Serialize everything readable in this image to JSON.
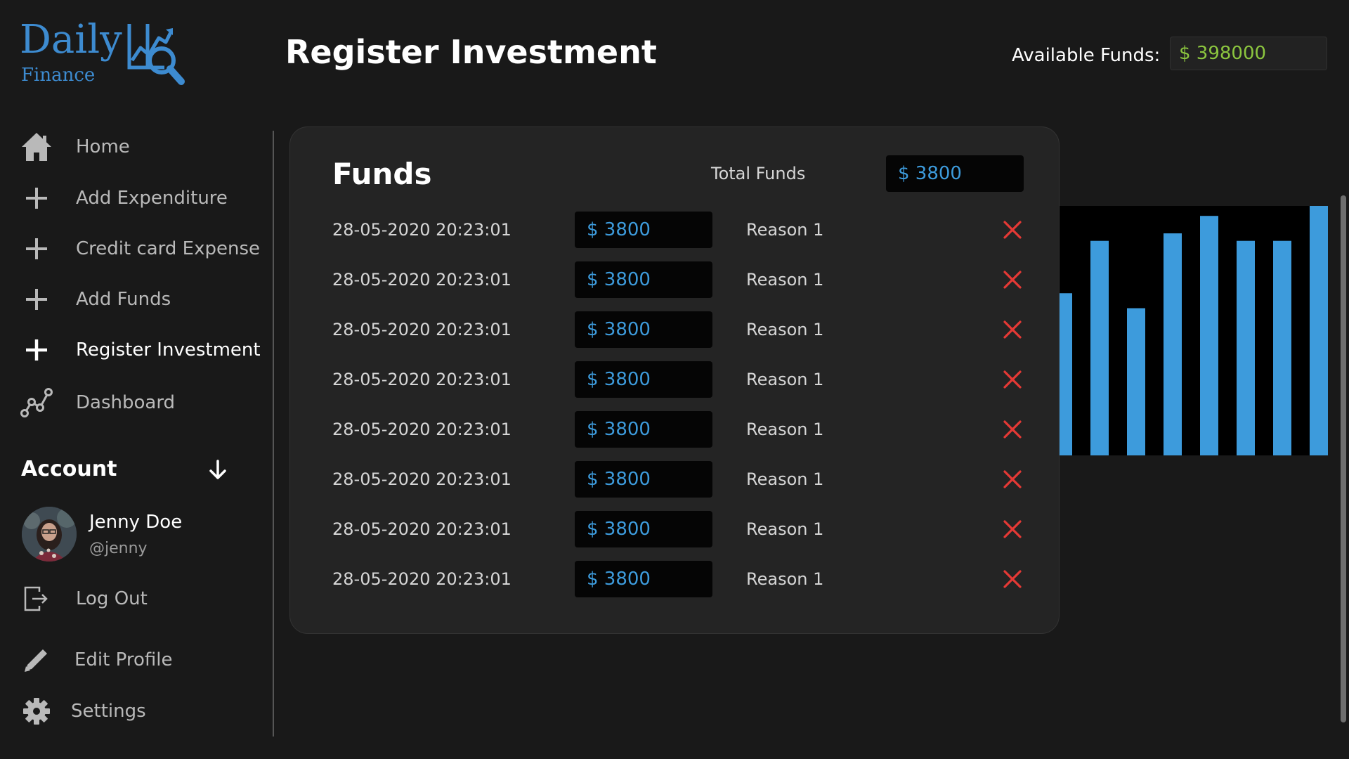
{
  "logo": {
    "line1": "Daily",
    "line2": "Finance",
    "icon": "chart-magnifier-icon",
    "color": "#3d8bd0"
  },
  "header": {
    "title": "Register Investment",
    "available_funds_label": "Available Funds:",
    "available_funds_value": "$ 398000",
    "available_funds_color": "#8cc63f"
  },
  "sidebar": {
    "items": [
      {
        "label": "Home",
        "icon": "home-icon",
        "active": false
      },
      {
        "label": "Add Expenditure",
        "icon": "plus-icon",
        "active": false
      },
      {
        "label": "Credit card Expense",
        "icon": "plus-icon",
        "active": false
      },
      {
        "label": "Add Funds",
        "icon": "plus-icon",
        "active": false
      },
      {
        "label": "Register Investment",
        "icon": "plus-icon",
        "active": true
      },
      {
        "label": "Dashboard",
        "icon": "line-graph-icon",
        "active": false
      }
    ],
    "account": {
      "label": "Account",
      "toggle_icon": "arrow-down-icon",
      "user_name": "Jenny Doe",
      "user_handle": "@jenny"
    },
    "bottom_items": [
      {
        "label": "Log Out",
        "icon": "logout-icon"
      },
      {
        "label": "Edit Profile",
        "icon": "pencil-icon"
      },
      {
        "label": "Settings",
        "icon": "gear-icon"
      }
    ]
  },
  "funds_panel": {
    "title": "Funds",
    "total_label": "Total Funds",
    "total_value": "$ 3800",
    "delete_icon": "close-icon",
    "rows": [
      {
        "date": "28-05-2020 20:23:01",
        "amount": "$ 3800",
        "reason": "Reason 1"
      },
      {
        "date": "28-05-2020 20:23:01",
        "amount": "$ 3800",
        "reason": "Reason 1"
      },
      {
        "date": "28-05-2020 20:23:01",
        "amount": "$ 3800",
        "reason": "Reason 1"
      },
      {
        "date": "28-05-2020 20:23:01",
        "amount": "$ 3800",
        "reason": "Reason 1"
      },
      {
        "date": "28-05-2020 20:23:01",
        "amount": "$ 3800",
        "reason": "Reason 1"
      },
      {
        "date": "28-05-2020 20:23:01",
        "amount": "$ 3800",
        "reason": "Reason 1"
      },
      {
        "date": "28-05-2020 20:23:01",
        "amount": "$ 3800",
        "reason": "Reason 1"
      },
      {
        "date": "28-05-2020 20:23:01",
        "amount": "$ 3800",
        "reason": "Reason 1"
      }
    ]
  },
  "background_chart": {
    "bar_color": "#3d9bdc",
    "bar_levels": [
      0.65,
      0.86,
      0.59,
      0.89,
      0.96,
      0.86,
      0.86,
      1.0
    ]
  }
}
